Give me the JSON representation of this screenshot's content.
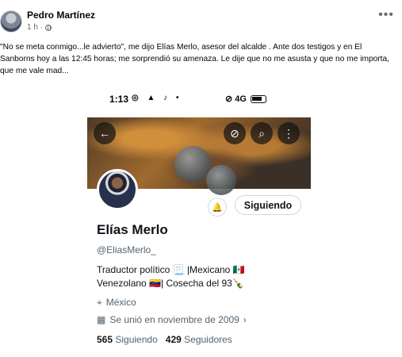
{
  "post": {
    "author": "Pedro Martínez",
    "time": "1 h ·",
    "text": "\"No se meta conmigo...le advierto\", me dijo Elías Merlo, asesor del alcalde . Ante dos testigos y en El Sanborns hoy a las 12:45  horas; me sorprendió su amenaza. Le dije que no me asusta y que no me importa, que me vale mad..."
  },
  "icons": {
    "more": "more-options-icon",
    "globe": "globe-icon",
    "back": "back-arrow-icon",
    "hide": "eye-slash-icon",
    "search": "search-icon",
    "menu": "vertical-dots-icon",
    "bell": "bell-icon",
    "location": "location-pin-icon",
    "calendar": "calendar-icon"
  },
  "screenshot": {
    "status": {
      "time": "1:13",
      "icons": "◎ ▲ ♪ •",
      "right": "⊘ 4G"
    },
    "profile": {
      "name": "Elías Merlo",
      "handle": "@EliasMerlo_",
      "bio_line1": "Traductor político 📃 |Mexicano 🇲🇽",
      "bio_line2": "Venezolano 🇻🇪| Cosecha del 93🍾",
      "location": "México",
      "joined": "Se unió en noviembre de 2009",
      "following_count": "565",
      "following_label": "Siguiendo",
      "followers_count": "429",
      "followers_label": "Seguidores",
      "follow_button": "Siguiendo"
    }
  }
}
